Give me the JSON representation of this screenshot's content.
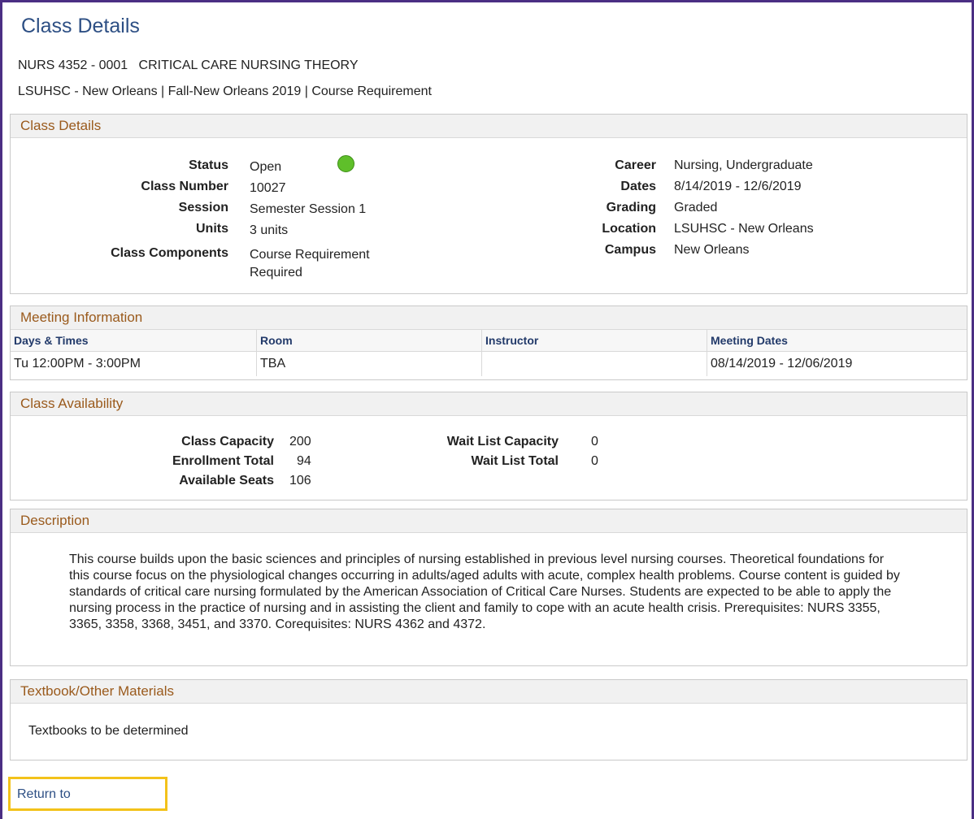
{
  "page_title": "Class Details",
  "course_line": "NURS 4352 - 0001   CRITICAL CARE NURSING THEORY",
  "institution_line": "LSUHSC - New Orleans | Fall-New Orleans 2019 | Course Requirement",
  "class_details": {
    "header": "Class Details",
    "left": [
      {
        "label": "Status",
        "value": "Open"
      },
      {
        "label": "Class Number",
        "value": "10027"
      },
      {
        "label": "Session",
        "value": "Semester Session 1"
      },
      {
        "label": "Units",
        "value": "3 units"
      },
      {
        "label": "Class Components",
        "value": "Course Requirement",
        "value2": "Required"
      }
    ],
    "right": [
      {
        "label": "Career",
        "value": "Nursing, Undergraduate"
      },
      {
        "label": "Dates",
        "value": "8/14/2019 - 12/6/2019"
      },
      {
        "label": "Grading",
        "value": "Graded"
      },
      {
        "label": "Location",
        "value": "LSUHSC - New Orleans"
      },
      {
        "label": "Campus",
        "value": "New Orleans"
      }
    ],
    "status_color": "#5fbf2a"
  },
  "meeting": {
    "header": "Meeting Information",
    "columns": [
      "Days & Times",
      "Room",
      "Instructor",
      "Meeting Dates"
    ],
    "rows": [
      [
        "Tu 12:00PM - 3:00PM",
        "TBA",
        "",
        "08/14/2019 - 12/06/2019"
      ]
    ]
  },
  "availability": {
    "header": "Class Availability",
    "left": [
      {
        "label": "Class Capacity",
        "value": "200"
      },
      {
        "label": "Enrollment Total",
        "value": "94"
      },
      {
        "label": "Available Seats",
        "value": "106"
      }
    ],
    "right": [
      {
        "label": "Wait List Capacity",
        "value": "0"
      },
      {
        "label": "Wait List Total",
        "value": "0"
      }
    ]
  },
  "description": {
    "header": "Description",
    "text": "This course builds upon the basic sciences and principles of nursing established in previous level nursing courses. Theoretical foundations for this course focus on the physiological changes occurring in adults/aged adults with acute, complex health problems. Course content is guided by standards of critical care nursing formulated by the American Association of Critical Care Nurses. Students are expected to be able to apply the nursing process in the practice of nursing and in assisting the client and family to cope with an acute health crisis. Prerequisites: NURS 3355, 3365, 3358, 3368, 3451, and 3370. Corequisites: NURS 4362 and 4372."
  },
  "textbook": {
    "header": "Textbook/Other Materials",
    "text": "Textbooks to be determined"
  },
  "return_link": "Return to"
}
